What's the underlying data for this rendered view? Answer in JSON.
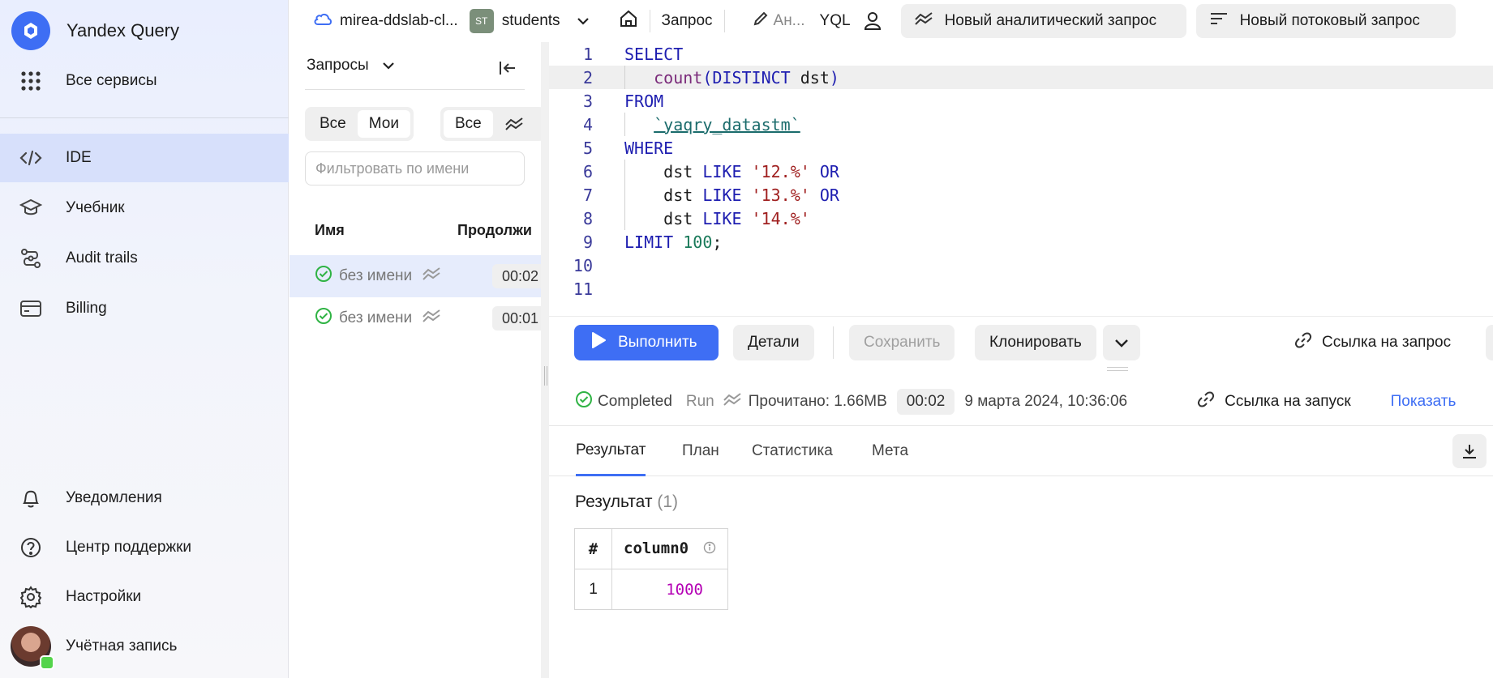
{
  "sidebar": {
    "brand": "Yandex Query",
    "all_services": "Все сервисы",
    "nav": [
      {
        "label": "IDE"
      },
      {
        "label": "Учебник"
      },
      {
        "label": "Audit trails"
      },
      {
        "label": "Billing"
      }
    ],
    "bottom": [
      {
        "label": "Уведомления"
      },
      {
        "label": "Центр поддержки"
      },
      {
        "label": "Настройки"
      },
      {
        "label": "Учётная запись"
      }
    ]
  },
  "topbar": {
    "cloud": "mirea-ddslab-cl...",
    "folder_badge": "ST",
    "folder": "students",
    "crumb": "Запрос",
    "query_name": "Ан...",
    "lang": "YQL",
    "new_analytic": "Новый аналитический запрос",
    "new_stream": "Новый потоковый запрос"
  },
  "queries": {
    "title": "Запросы",
    "seg1": [
      "Все",
      "Мои"
    ],
    "seg2": [
      "Все"
    ],
    "filter_placeholder": "Фильтровать по имени",
    "col_name": "Имя",
    "col_duration": "Продолжи",
    "rows": [
      {
        "name": "без имени",
        "time": "00:02"
      },
      {
        "name": "без имени",
        "time": "00:01"
      }
    ]
  },
  "editor": {
    "line_numbers": [
      "1",
      "2",
      "3",
      "4",
      "5",
      "6",
      "7",
      "8",
      "9",
      "10",
      "11"
    ]
  },
  "actions": {
    "run": "Выполнить",
    "details": "Детали",
    "save": "Сохранить",
    "clone": "Клонировать",
    "link": "Ссылка на запрос"
  },
  "status": {
    "state": "Completed",
    "type": "Run",
    "read": "Прочитано: 1.66MB",
    "duration": "00:02",
    "date": "9 марта 2024, 10:36:06",
    "run_link": "Ссылка на запуск",
    "show": "Показать"
  },
  "tabs": [
    "Результат",
    "План",
    "Статистика",
    "Мета"
  ],
  "result": {
    "title": "Результат",
    "count": "(1)",
    "headers": [
      "#",
      "column0"
    ],
    "rows": [
      [
        "1",
        "1000"
      ]
    ]
  },
  "colors": {
    "accent": "#3e6ef4",
    "success": "#2fb344",
    "value": "#b400b4"
  }
}
